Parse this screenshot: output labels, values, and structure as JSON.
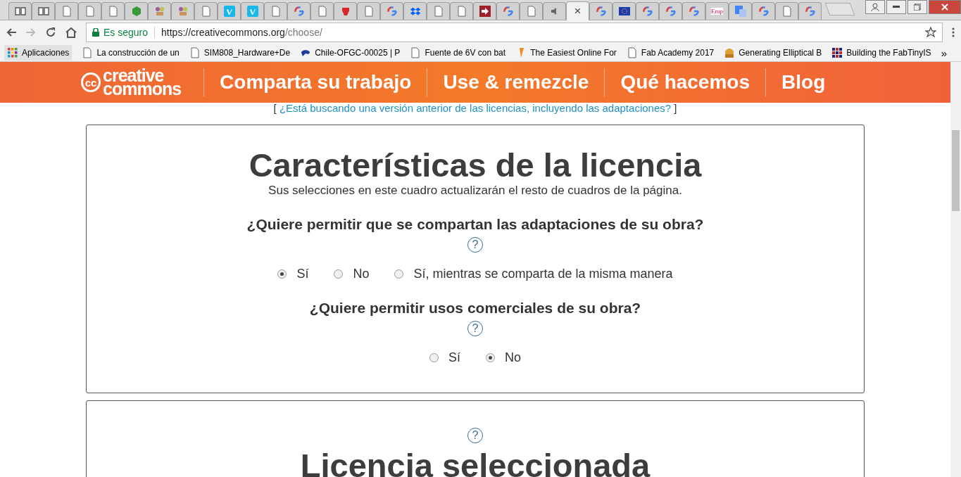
{
  "browser": {
    "tabs": [
      {
        "kind": "book",
        "selected": false
      },
      {
        "kind": "book",
        "selected": false
      },
      {
        "kind": "page",
        "selected": false
      },
      {
        "kind": "page",
        "selected": false
      },
      {
        "kind": "page",
        "selected": false
      },
      {
        "kind": "hexagon",
        "selected": false
      },
      {
        "kind": "people",
        "selected": false
      },
      {
        "kind": "people",
        "selected": false
      },
      {
        "kind": "page",
        "selected": false
      },
      {
        "kind": "vimeo",
        "selected": false
      },
      {
        "kind": "vimeo",
        "selected": false
      },
      {
        "kind": "page",
        "selected": false
      },
      {
        "kind": "google",
        "selected": false
      },
      {
        "kind": "page",
        "selected": false
      },
      {
        "kind": "emblem",
        "selected": false
      },
      {
        "kind": "page",
        "selected": false
      },
      {
        "kind": "google",
        "selected": false
      },
      {
        "kind": "dropbox",
        "selected": false
      },
      {
        "kind": "page",
        "selected": false
      },
      {
        "kind": "page",
        "selected": false
      },
      {
        "kind": "arrow",
        "selected": false
      },
      {
        "kind": "google",
        "selected": false
      },
      {
        "kind": "page",
        "selected": false
      },
      {
        "kind": "speaker",
        "selected": false
      },
      {
        "kind": "close",
        "selected": true,
        "label": "×"
      },
      {
        "kind": "google",
        "selected": false
      },
      {
        "kind": "flag",
        "selected": false
      },
      {
        "kind": "google",
        "selected": false
      },
      {
        "kind": "google",
        "selected": false
      },
      {
        "kind": "google",
        "selected": false
      },
      {
        "kind": "text",
        "selected": false,
        "label": "Emp"
      },
      {
        "kind": "translate",
        "selected": false
      },
      {
        "kind": "google",
        "selected": false
      },
      {
        "kind": "page",
        "selected": false
      },
      {
        "kind": "google",
        "selected": false
      }
    ],
    "security": "Es seguro",
    "url_host": "https://creativecommons.org",
    "url_path": "/choose/",
    "bookmarks": [
      {
        "kind": "apps",
        "label": "Aplicaciones"
      },
      {
        "kind": "page",
        "label": "La construcción de un"
      },
      {
        "kind": "page",
        "label": "SIM808_Hardware+De"
      },
      {
        "kind": "logo",
        "label": "Chile-OFGC-00025 | P"
      },
      {
        "kind": "page",
        "label": "Fuente de 6V con bat"
      },
      {
        "kind": "pencil",
        "label": "The Easiest Online For"
      },
      {
        "kind": "page",
        "label": "Fab Academy 2017"
      },
      {
        "kind": "cartoon",
        "label": "Generating Elliptical B"
      },
      {
        "kind": "grid",
        "label": "Building the FabTinyIS"
      }
    ],
    "more": "»"
  },
  "site": {
    "logo_mark": "cc",
    "logo_top": "creative",
    "logo_bottom": "commons",
    "nav": [
      "Comparta su trabajo",
      "Use & remezcle",
      "Qué hacemos",
      "Blog"
    ],
    "notice_open": "[",
    "notice_link": "¿Está buscando una versión anterior de las licencias, incluyendo las adaptaciones?",
    "notice_close": "]"
  },
  "features": {
    "title": "Características de la licencia",
    "subtitle": "Sus selecciones en este cuadro actualizarán el resto de cuadros de la página.",
    "questions": [
      {
        "question": "¿Quiere permitir que se compartan las adaptaciones de su obra?",
        "help": "?",
        "options": [
          {
            "label": "Sí",
            "selected": true
          },
          {
            "label": "No",
            "selected": false
          },
          {
            "label": "Sí, mientras se comparta de la misma manera",
            "selected": false
          }
        ]
      },
      {
        "question": "¿Quiere permitir usos comerciales de su obra?",
        "help": "?",
        "options": [
          {
            "label": "Sí",
            "selected": false
          },
          {
            "label": "No",
            "selected": true
          }
        ]
      }
    ]
  },
  "selected_license": {
    "help": "?",
    "title": "Licencia seleccionada"
  }
}
